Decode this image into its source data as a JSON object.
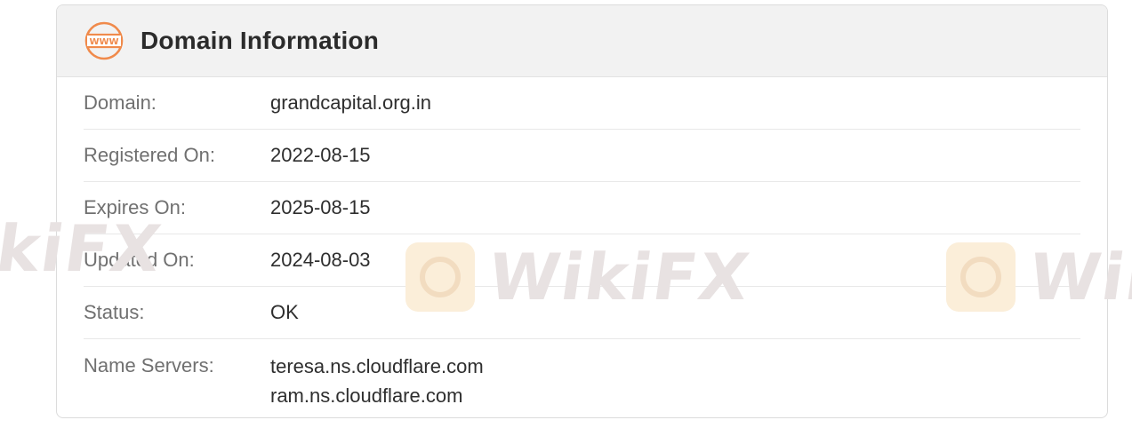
{
  "card": {
    "icon": "www-globe-icon",
    "title": "Domain Information"
  },
  "rows": [
    {
      "label": "Domain:",
      "value": "grandcapital.org.in"
    },
    {
      "label": "Registered On:",
      "value": "2022-08-15"
    },
    {
      "label": "Expires On:",
      "value": "2025-08-15"
    },
    {
      "label": "Updated On:",
      "value": "2024-08-03"
    },
    {
      "label": "Status:",
      "value": "OK"
    },
    {
      "label": "Name Servers:",
      "values": [
        "teresa.ns.cloudflare.com",
        "ram.ns.cloudflare.com"
      ]
    }
  ],
  "watermark": {
    "text": "WikiFX",
    "left_partial": "ikiFX",
    "right_partial": "Wiki"
  },
  "colors": {
    "accent": "#f08a4b",
    "header_bg": "#f2f2f2",
    "label": "#707070",
    "value": "#2e2e2e"
  }
}
